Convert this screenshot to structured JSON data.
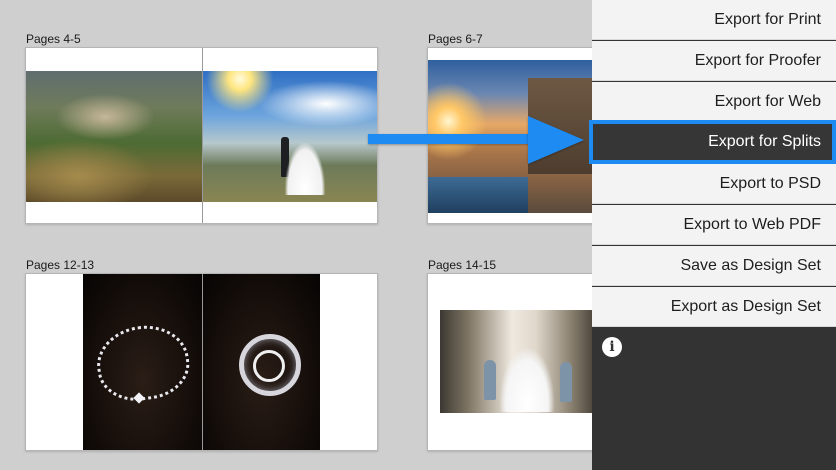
{
  "spreads": [
    {
      "label": "Pages 4-5"
    },
    {
      "label": "Pages 6-7"
    },
    {
      "label": "Pages 12-13"
    },
    {
      "label": "Pages 14-15"
    }
  ],
  "menu": {
    "items": [
      {
        "label": "Export for Print",
        "selected": false
      },
      {
        "label": "Export for Proofer",
        "selected": false
      },
      {
        "label": "Export for Web",
        "selected": false
      },
      {
        "label": "Export for Splits",
        "selected": true
      },
      {
        "label": "Export to PSD",
        "selected": false
      },
      {
        "label": "Export to Web PDF",
        "selected": false
      },
      {
        "label": "Save as Design Set",
        "selected": false
      },
      {
        "label": "Export as Design Set",
        "selected": false
      }
    ],
    "info_icon": "info-icon",
    "info_glyph": "i"
  },
  "colors": {
    "accent": "#1d8bf1",
    "menu_dark": "#333333",
    "canvas": "#cfcfcf"
  }
}
